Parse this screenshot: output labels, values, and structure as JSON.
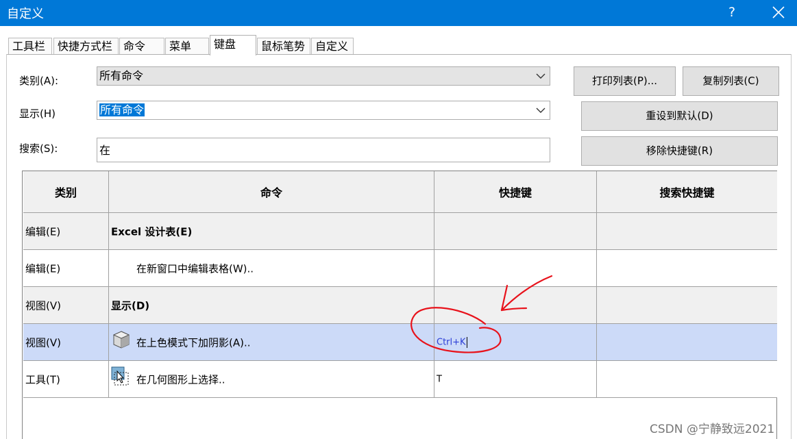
{
  "window": {
    "title": "自定义",
    "help_label": "?"
  },
  "tabs": [
    {
      "label": "工具栏"
    },
    {
      "label": "快捷方式栏"
    },
    {
      "label": "命令"
    },
    {
      "label": "菜单"
    },
    {
      "label": "键盘",
      "active": true
    },
    {
      "label": "鼠标笔势"
    },
    {
      "label": "自定义"
    }
  ],
  "filters": {
    "category_label": "类别(A):",
    "category_value": "所有命令",
    "show_label": "显示(H)",
    "show_value": "所有命令",
    "search_label": "搜索(S):",
    "search_value": "在"
  },
  "buttons": {
    "print_list": "打印列表(P)...",
    "copy_list": "复制列表(C)",
    "reset_default": "重设到默认(D)",
    "remove_shortcut": "移除快捷键(R)"
  },
  "table": {
    "headers": [
      "类别",
      "命令",
      "快捷键",
      "搜索快捷键"
    ],
    "rows": [
      {
        "category": "编辑(E)",
        "command": "Excel 设计表(E)",
        "shortcut": "",
        "search_shortcut": "",
        "style": "group"
      },
      {
        "category": "编辑(E)",
        "command": "在新窗口中编辑表格(W)..",
        "shortcut": "",
        "search_shortcut": "",
        "style": "item"
      },
      {
        "category": "视图(V)",
        "command": "显示(D)",
        "shortcut": "",
        "search_shortcut": "",
        "style": "group"
      },
      {
        "category": "视图(V)",
        "command": "在上色模式下加阴影(A)..",
        "shortcut": "Ctrl+K",
        "search_shortcut": "",
        "style": "selected",
        "icon": "shaded-cube-icon"
      },
      {
        "category": "工具(T)",
        "command": "在几何图形上选择..",
        "shortcut": "T",
        "search_shortcut": "",
        "style": "item",
        "icon": "select-geometry-icon"
      }
    ]
  },
  "annotation": {
    "color": "#e8121b"
  },
  "watermark": "CSDN @宁静致远2021",
  "colors": {
    "titlebar": "#0078d7",
    "selected_row": "#ccdaf8",
    "group_row": "#f0f0f0"
  }
}
